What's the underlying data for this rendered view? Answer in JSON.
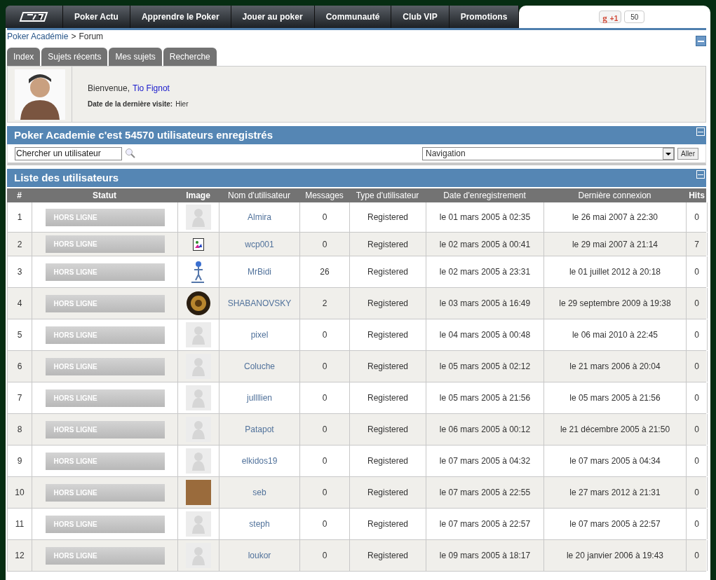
{
  "nav": {
    "items": [
      "Poker Actu",
      "Apprendre le Poker",
      "Jouer au poker",
      "Communauté",
      "Club VIP",
      "Promotions"
    ],
    "plus_logo": "g",
    "plus_one": "+1",
    "plus_count": "50"
  },
  "breadcrumb": {
    "home": "Poker Académie",
    "separator": ">",
    "current": "Forum"
  },
  "tabs": [
    {
      "label": "Index",
      "selected": false
    },
    {
      "label": "Sujets récents",
      "selected": false
    },
    {
      "label": "Mes sujets",
      "selected": false
    },
    {
      "label": "Recherche",
      "selected": false
    }
  ],
  "welcome": {
    "greeting": "Bienvenue,",
    "user": "Tio Fignot",
    "last_visit_label": "Date de la dernière visite:",
    "last_visit": "Hier"
  },
  "stats_panel": {
    "title": "Poker Academie c'est 54570 utilisateurs enregistrés",
    "search_value": "Chercher un utilisateur",
    "navigation": "Navigation",
    "go": "Aller"
  },
  "table": {
    "title": "Liste des utilisateurs",
    "columns": [
      "#",
      "Statut",
      "Image",
      "Nom d'utilisateur",
      "Messages",
      "Type d'utilisateur",
      "Date d'enregistrement",
      "Dernière connexion",
      "Hits"
    ],
    "rows": [
      {
        "n": "1",
        "status": "HORS LIGNE",
        "kind": "default",
        "name": "Almira",
        "messages": "0",
        "type": "Registered",
        "registered": "le 01 mars 2005 à 02:35",
        "last": "le 26 mai 2007 à 22:30",
        "hits": "0"
      },
      {
        "n": "2",
        "status": "HORS LIGNE",
        "kind": "broken",
        "name": "wcp001",
        "messages": "0",
        "type": "Registered",
        "registered": "le 02 mars 2005 à 00:41",
        "last": "le 29 mai 2007 à 21:14",
        "hits": "7"
      },
      {
        "n": "3",
        "status": "HORS LIGNE",
        "kind": "figure",
        "name": "MrBidi",
        "messages": "26",
        "type": "Registered",
        "registered": "le 02 mars 2005 à 23:31",
        "last": "le 01 juillet 2012 à 20:18",
        "hits": "0"
      },
      {
        "n": "4",
        "status": "HORS LIGNE",
        "kind": "emblem",
        "name": "SHABANOVSKY",
        "messages": "2",
        "type": "Registered",
        "registered": "le 03 mars 2005 à 16:49",
        "last": "le 29 septembre 2009 à 19:38",
        "hits": "0"
      },
      {
        "n": "5",
        "status": "HORS LIGNE",
        "kind": "default",
        "name": "pixel",
        "messages": "0",
        "type": "Registered",
        "registered": "le 04 mars 2005 à 00:48",
        "last": "le 06 mai 2010 à 22:45",
        "hits": "0"
      },
      {
        "n": "6",
        "status": "HORS LIGNE",
        "kind": "default",
        "name": "Coluche",
        "messages": "0",
        "type": "Registered",
        "registered": "le 05 mars 2005 à 02:12",
        "last": "le 21 mars 2006 à 20:04",
        "hits": "0"
      },
      {
        "n": "7",
        "status": "HORS LIGNE",
        "kind": "default",
        "name": "jullllien",
        "messages": "0",
        "type": "Registered",
        "registered": "le 05 mars 2005 à 21:56",
        "last": "le 05 mars 2005 à 21:56",
        "hits": "0"
      },
      {
        "n": "8",
        "status": "HORS LIGNE",
        "kind": "default",
        "name": "Patapot",
        "messages": "0",
        "type": "Registered",
        "registered": "le 06 mars 2005 à 00:12",
        "last": "le 21 décembre 2005 à 21:50",
        "hits": "0"
      },
      {
        "n": "9",
        "status": "HORS LIGNE",
        "kind": "default",
        "name": "elkidos19",
        "messages": "0",
        "type": "Registered",
        "registered": "le 07 mars 2005 à 04:32",
        "last": "le 07 mars 2005 à 04:34",
        "hits": "0"
      },
      {
        "n": "10",
        "status": "HORS LIGNE",
        "kind": "photo",
        "name": "seb",
        "messages": "0",
        "type": "Registered",
        "registered": "le 07 mars 2005 à 22:55",
        "last": "le 27 mars 2012 à 21:31",
        "hits": "0"
      },
      {
        "n": "11",
        "status": "HORS LIGNE",
        "kind": "default",
        "name": "steph",
        "messages": "0",
        "type": "Registered",
        "registered": "le 07 mars 2005 à 22:57",
        "last": "le 07 mars 2005 à 22:57",
        "hits": "0"
      },
      {
        "n": "12",
        "status": "HORS LIGNE",
        "kind": "default",
        "name": "loukor",
        "messages": "0",
        "type": "Registered",
        "registered": "le 09 mars 2005 à 18:17",
        "last": "le 20 janvier 2006 à 19:43",
        "hits": "0"
      }
    ]
  }
}
